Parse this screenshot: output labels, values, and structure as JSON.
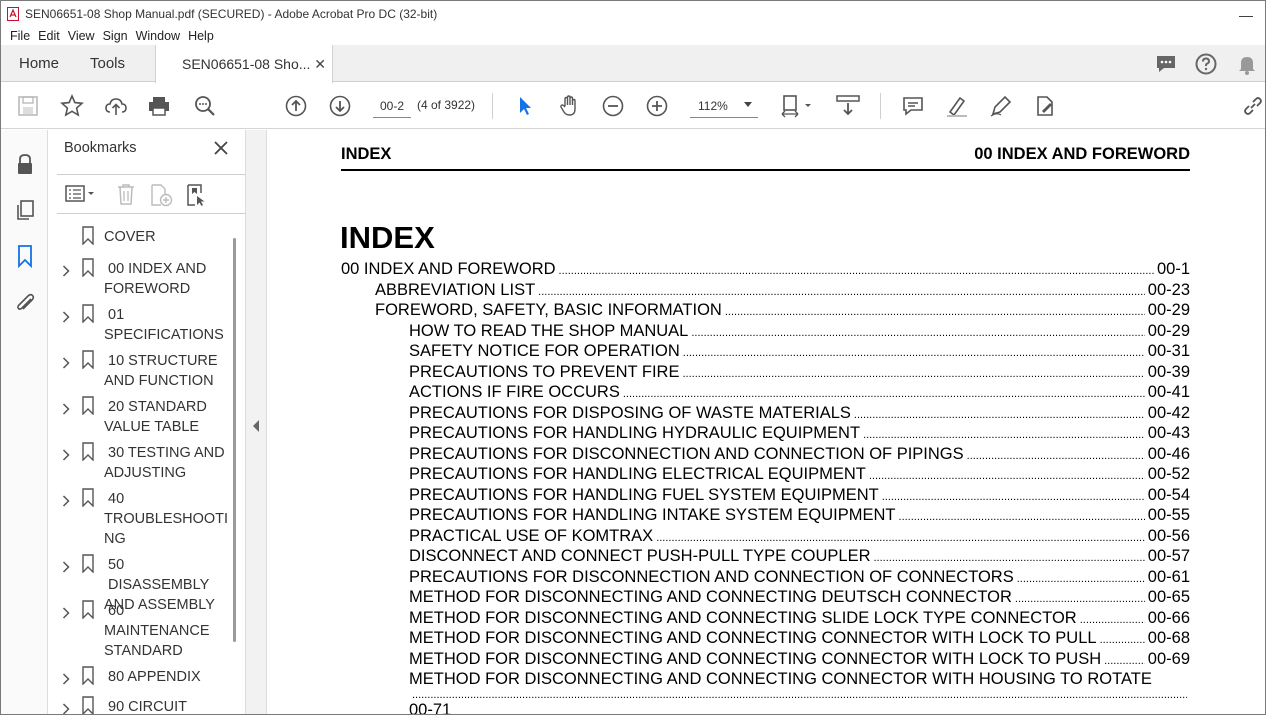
{
  "window": {
    "title": "SEN06651-08 Shop Manual.pdf (SECURED) - Adobe Acrobat Pro DC (32-bit)"
  },
  "menu": [
    "File",
    "Edit",
    "View",
    "Sign",
    "Window",
    "Help"
  ],
  "tabs": {
    "home": "Home",
    "tools": "Tools",
    "doc": "SEN06651-08 Sho..."
  },
  "toolbar": {
    "page_value": "00-2",
    "page_count": "(4 of 3922)",
    "zoom": "112%"
  },
  "bookmarks": {
    "title": "Bookmarks",
    "items": [
      {
        "l1": "COVER",
        "l2": "",
        "l3": ""
      },
      {
        "l1": "00 INDEX AND",
        "l2": "FOREWORD",
        "l3": ""
      },
      {
        "l1": "01",
        "l2": "SPECIFICATIONS",
        "l3": ""
      },
      {
        "l1": "10 STRUCTURE",
        "l2": "AND FUNCTION",
        "l3": ""
      },
      {
        "l1": "20 STANDARD",
        "l2": "VALUE TABLE",
        "l3": ""
      },
      {
        "l1": "30 TESTING AND",
        "l2": "ADJUSTING",
        "l3": ""
      },
      {
        "l1": "40",
        "l2": "TROUBLESHOOTI",
        "l3": "NG"
      },
      {
        "l1": "50 DISASSEMBLY",
        "l2": "AND ASSEMBLY",
        "l3": ""
      },
      {
        "l1": "60",
        "l2": "MAINTENANCE",
        "l3": "STANDARD"
      },
      {
        "l1": "80 APPENDIX",
        "l2": "",
        "l3": ""
      },
      {
        "l1": "90 CIRCUIT",
        "l2": "",
        "l3": ""
      }
    ]
  },
  "page": {
    "header_left": "INDEX",
    "header_right": "00 INDEX AND FOREWORD",
    "title": "INDEX",
    "toc": [
      {
        "text": "00 INDEX AND FOREWORD",
        "page": "00-1"
      },
      {
        "text": "ABBREVIATION LIST",
        "page": "00-23"
      },
      {
        "text": "FOREWORD, SAFETY, BASIC INFORMATION",
        "page": "00-29"
      },
      {
        "text": "HOW TO READ THE SHOP MANUAL",
        "page": "00-29"
      },
      {
        "text": "SAFETY NOTICE FOR OPERATION",
        "page": "00-31"
      },
      {
        "text": "PRECAUTIONS TO PREVENT FIRE",
        "page": "00-39"
      },
      {
        "text": "ACTIONS IF FIRE OCCURS",
        "page": "00-41"
      },
      {
        "text": "PRECAUTIONS FOR DISPOSING OF WASTE MATERIALS",
        "page": "00-42"
      },
      {
        "text": "PRECAUTIONS FOR HANDLING HYDRAULIC EQUIPMENT",
        "page": "00-43"
      },
      {
        "text": "PRECAUTIONS FOR DISCONNECTION AND CONNECTION OF PIPINGS",
        "page": "00-46"
      },
      {
        "text": "PRECAUTIONS FOR HANDLING ELECTRICAL EQUIPMENT",
        "page": "00-52"
      },
      {
        "text": "PRECAUTIONS FOR HANDLING FUEL SYSTEM EQUIPMENT",
        "page": "00-54"
      },
      {
        "text": "PRECAUTIONS FOR HANDLING INTAKE SYSTEM EQUIPMENT",
        "page": "00-55"
      },
      {
        "text": "PRACTICAL USE OF KOMTRAX",
        "page": "00-56"
      },
      {
        "text": "DISCONNECT AND CONNECT PUSH-PULL TYPE COUPLER",
        "page": "00-57"
      },
      {
        "text": "PRECAUTIONS FOR DISCONNECTION AND CONNECTION OF CONNECTORS",
        "page": "00-61"
      },
      {
        "text": "METHOD FOR DISCONNECTING AND CONNECTING DEUTSCH CONNECTOR",
        "page": "00-65"
      },
      {
        "text": "METHOD FOR DISCONNECTING AND CONNECTING SLIDE LOCK TYPE CONNECTOR",
        "page": "00-66"
      },
      {
        "text": "METHOD FOR DISCONNECTING AND CONNECTING CONNECTOR WITH LOCK TO PULL",
        "page": "00-68"
      },
      {
        "text": "METHOD FOR DISCONNECTING AND CONNECTING CONNECTOR WITH LOCK TO PUSH",
        "page": "00-69"
      },
      {
        "text": "METHOD FOR DISCONNECTING AND CONNECTING CONNECTOR WITH HOUSING TO ROTATE",
        "page": "00-71"
      }
    ]
  }
}
